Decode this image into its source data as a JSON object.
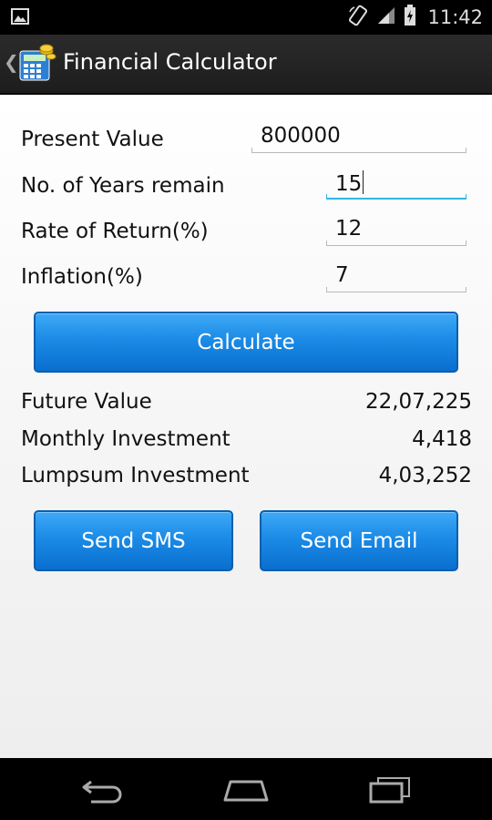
{
  "status_bar": {
    "time": "11:42",
    "icons": [
      "image-icon",
      "rotate-icon",
      "signal-icon",
      "battery-icon"
    ]
  },
  "action_bar": {
    "title": "Financial Calculator",
    "icon": "calculator-icon"
  },
  "form": {
    "present_value": {
      "label": "Present Value",
      "value": "800000"
    },
    "years": {
      "label": "No. of Years remain",
      "value": "15"
    },
    "rate": {
      "label": "Rate of Return(%)",
      "value": "12"
    },
    "inflation": {
      "label": "Inflation(%)",
      "value": "7"
    }
  },
  "buttons": {
    "calculate": "Calculate",
    "send_sms": "Send SMS",
    "send_email": "Send Email"
  },
  "results": {
    "future_value": {
      "label": "Future Value",
      "value": "22,07,225"
    },
    "monthly": {
      "label": "Monthly Investment",
      "value": "4,418"
    },
    "lumpsum": {
      "label": "Lumpsum Investment",
      "value": "4,03,252"
    }
  },
  "colors": {
    "accent": "#33b5e5",
    "button": "#1b8be6",
    "background": "#ffffff"
  }
}
